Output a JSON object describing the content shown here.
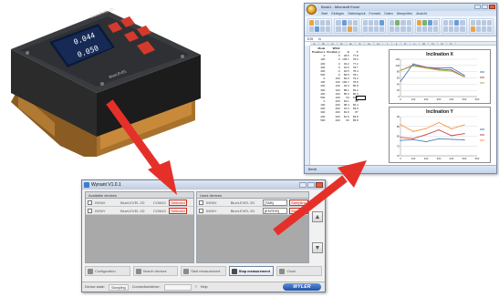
{
  "device": {
    "brand_label": "BlueLEVEL 2D",
    "reading_x": "0.044",
    "reading_y": "0.050",
    "footer_label": "BlueLEVEL"
  },
  "excel": {
    "title": "Book1 - Microsoft Excel",
    "tabs": [
      "Start",
      "Einfügen",
      "Seitenlayout",
      "Formeln",
      "Daten",
      "Überprüfen",
      "Ansicht"
    ],
    "name_box": "E25",
    "columns": [
      "A",
      "B",
      "C",
      "D",
      "E",
      "F",
      "G",
      "H",
      "I",
      "J",
      "K",
      "L",
      "M",
      "N",
      "O",
      "P"
    ],
    "table": {
      "header1": [
        "Mode",
        "WS11",
        "",
        ""
      ],
      "header2": [
        "Position x",
        "Position y",
        "X",
        "Y"
      ],
      "rows": [
        [
          "0",
          "0",
          "48.5",
          "77.8"
        ],
        [
          "100",
          "0",
          "105.1",
          "78.3"
        ],
        [
          "200",
          "0",
          "94.2",
          "77.2"
        ],
        [
          "300",
          "0",
          "91.6",
          "78.7"
        ],
        [
          "400",
          "0",
          "92.5",
          "78.4"
        ],
        [
          "500",
          "0",
          "68.5",
          "78.1"
        ],
        [
          "0",
          "100",
          "84.0",
          "79.4"
        ],
        [
          "100",
          "100",
          "100.7",
          "78.8"
        ],
        [
          "200",
          "100",
          "94.3",
          "80.8"
        ],
        [
          "300",
          "100",
          "88.1",
          "83.2"
        ],
        [
          "400",
          "100",
          "85.3",
          "80.3"
        ],
        [
          "500",
          "100",
          "64",
          "81.3"
        ],
        [
          "0",
          "200",
          "84.1",
          "86"
        ],
        [
          "100",
          "200",
          "98.4",
          "82.4"
        ],
        [
          "200",
          "200",
          "91.3",
          "83.9"
        ],
        [
          "300",
          "200",
          "84.9",
          "87"
        ],
        [
          "400",
          "200",
          "81.9",
          "83.8"
        ],
        [
          "500",
          "200",
          "63",
          "85.8"
        ]
      ]
    },
    "charts": [
      {
        "title": "Inclination X",
        "chart_data": {
          "type": "line",
          "title": "Inclination X",
          "x": [
            0,
            100,
            200,
            300,
            400,
            500
          ],
          "ylim": [
            0,
            120
          ],
          "yticks": [
            0,
            20,
            40,
            60,
            80,
            100,
            120
          ],
          "xticks": [
            0,
            100,
            200,
            300,
            400,
            500,
            600
          ],
          "series": [
            {
              "values": [
                48.5,
                105.1,
                94.2,
                91.6,
                92.5,
                68.5
              ],
              "color": "#4a7ebb"
            },
            {
              "values": [
                84.0,
                100.7,
                94.3,
                88.1,
                85.3,
                64
              ],
              "color": "#be4b48"
            },
            {
              "values": [
                84.1,
                98.4,
                91.3,
                84.9,
                81.9,
                63
              ],
              "color": "#98b954"
            }
          ],
          "grid": true,
          "legend": "right"
        }
      },
      {
        "title": "Inclination Y",
        "chart_data": {
          "type": "line",
          "title": "Inclination Y",
          "x": [
            0,
            100,
            200,
            300,
            400,
            500
          ],
          "ylim": [
            70,
            90
          ],
          "yticks": [
            70,
            75,
            80,
            85,
            90
          ],
          "xticks": [
            0,
            100,
            200,
            300,
            400,
            500,
            600
          ],
          "series": [
            {
              "values": [
                77.8,
                78.3,
                77.2,
                78.7,
                78.4,
                78.1
              ],
              "color": "#4a7ebb"
            },
            {
              "values": [
                79.4,
                78.8,
                80.8,
                83.2,
                80.3,
                81.3
              ],
              "color": "#be4b48"
            },
            {
              "values": [
                86,
                82.4,
                83.9,
                87,
                83.8,
                85.8
              ],
              "color": "#f79646"
            }
          ],
          "grid": true,
          "legend": "right"
        }
      }
    ],
    "status": "Bereit"
  },
  "wynant": {
    "title": "Wynant V1.0.1",
    "left_panel_header": "Available devices",
    "right_panel_header": "Used devices",
    "left_rows": [
      {
        "device": "INS6X",
        "model": "BlueLEVEL 2D",
        "port": "COM10",
        "state": "Selected"
      },
      {
        "device": "INS6Y",
        "model": "BlueLEVEL 2D",
        "port": "COM10",
        "state": "Selected"
      }
    ],
    "right_rows": [
      {
        "device": "INS6X",
        "model": "BlueLEVEL 2D",
        "mode": "[TAB]",
        "state": "Sampling"
      },
      {
        "device": "INS6Y",
        "model": "BlueLEVEL 2D",
        "mode": "[ENTER]",
        "state": "Sampling"
      }
    ],
    "toolbar": [
      {
        "label": "Configuration",
        "active": false
      },
      {
        "label": "Search devices",
        "active": false
      },
      {
        "label": "Start measurement",
        "active": false
      },
      {
        "label": "Stop measurement",
        "active": true
      },
      {
        "label": "Close",
        "active": false
      }
    ],
    "status": {
      "label_state": "Device state:",
      "state": "Sampling",
      "label_conn": "Connection/driver:",
      "help": "Help",
      "logo": "WYLER"
    }
  }
}
